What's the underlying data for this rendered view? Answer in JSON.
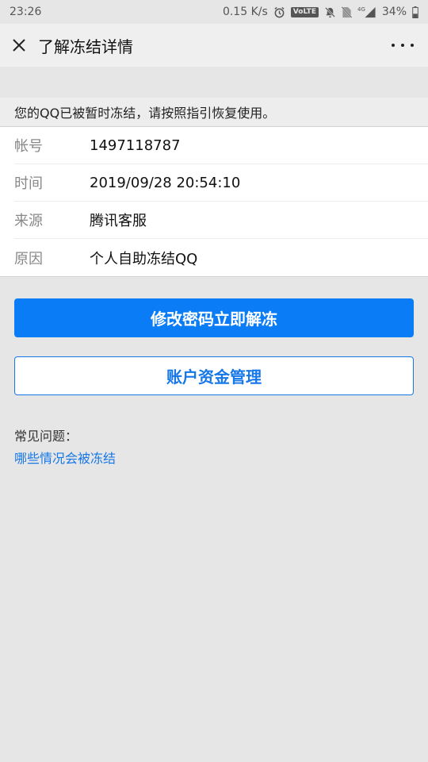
{
  "status_bar": {
    "time": "23:26",
    "net_speed": "0.15 K/s",
    "volte": "VoLTE",
    "network_type": "4G",
    "battery": "34%",
    "icons": [
      "alarm-icon",
      "volte-icon",
      "mute-bell-icon",
      "no-sim-icon",
      "signal-icon",
      "battery-icon"
    ]
  },
  "nav": {
    "title": "了解冻结详情",
    "close_icon": "close-icon",
    "more_icon": "more-icon"
  },
  "notice": "您的QQ已被暂时冻结，请按照指引恢复使用。",
  "info_rows": [
    {
      "label": "帐号",
      "value": "1497118787"
    },
    {
      "label": "时间",
      "value": "2019/09/28  20:54:10"
    },
    {
      "label": "来源",
      "value": "腾讯客服"
    },
    {
      "label": "原因",
      "value": "个人自助冻结QQ"
    }
  ],
  "buttons": {
    "primary": "修改密码立即解冻",
    "secondary": "账户资金管理"
  },
  "faq": {
    "title": "常见问题：",
    "link": "哪些情况会被冻结"
  },
  "colors": {
    "primary": "#0a7cf5",
    "link": "#1677e8",
    "background": "#e6e6e6"
  }
}
